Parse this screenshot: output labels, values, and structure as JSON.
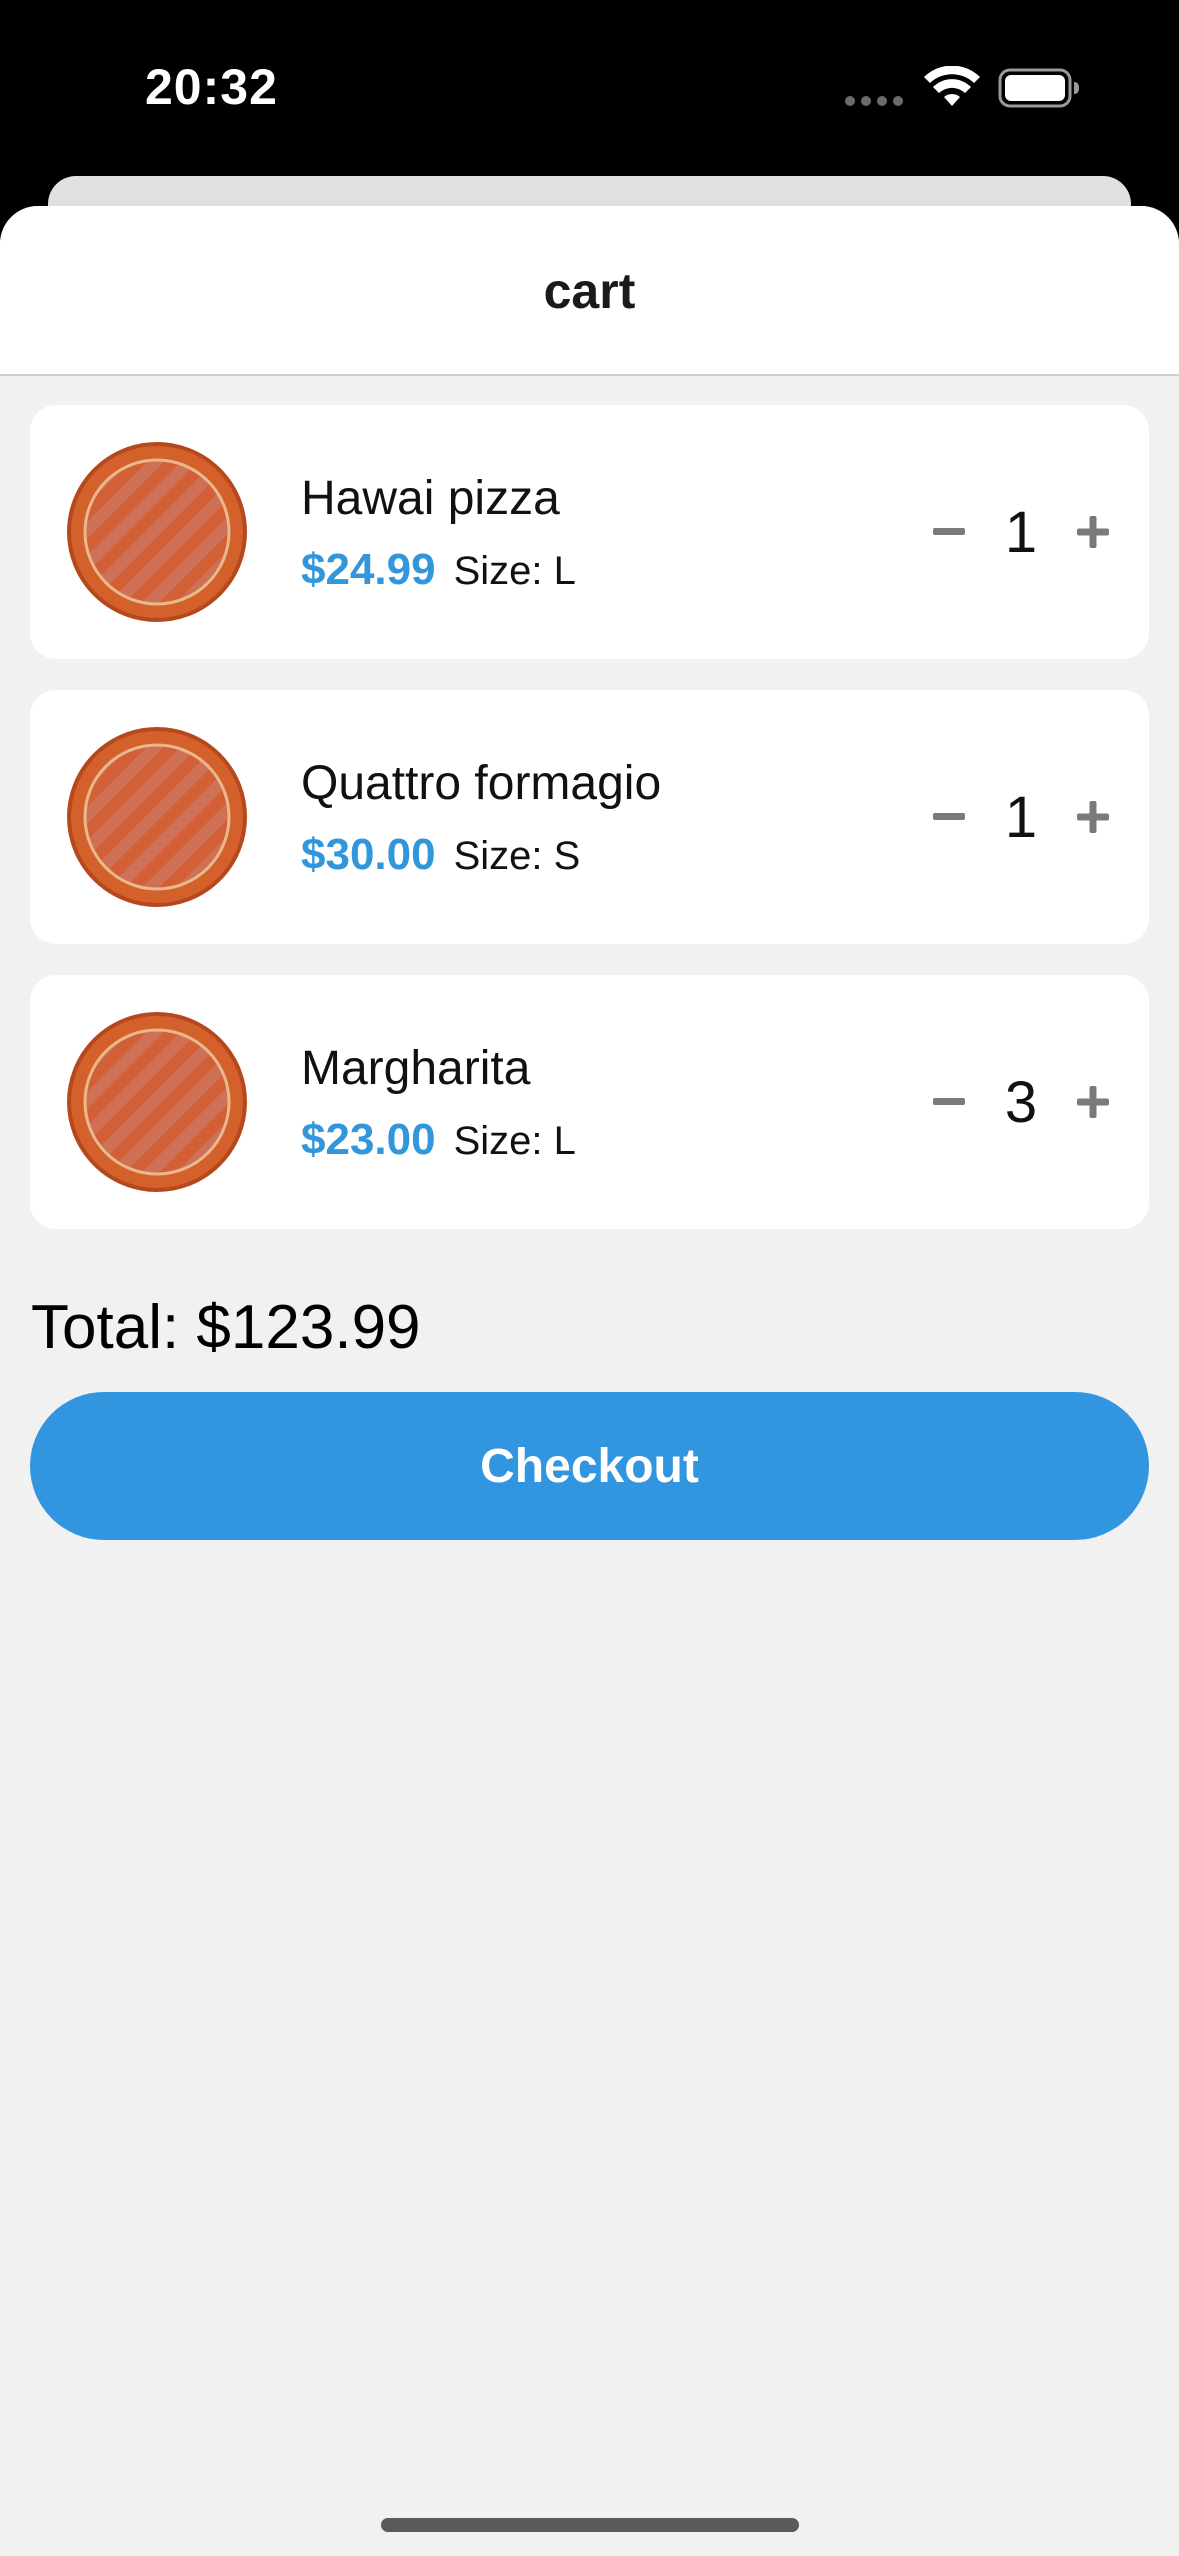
{
  "status_bar": {
    "time": "20:32"
  },
  "header": {
    "title": "cart"
  },
  "cart": {
    "items": [
      {
        "name": "Hawai pizza",
        "price": "$24.99",
        "size": "Size: L",
        "quantity": "1"
      },
      {
        "name": "Quattro formagio",
        "price": "$30.00",
        "size": "Size: S",
        "quantity": "1"
      },
      {
        "name": "Margharita",
        "price": "$23.00",
        "size": "Size: L",
        "quantity": "3"
      }
    ],
    "total": "Total: $123.99",
    "checkout_label": "Checkout"
  },
  "colors": {
    "accent": "#3196df",
    "price": "#3196db",
    "pizza_crust": "#d4602c",
    "background": "#f1f1f1"
  },
  "icons": {
    "item_image": "pizza-icon",
    "decrease": "minus-icon",
    "increase": "plus-icon"
  }
}
